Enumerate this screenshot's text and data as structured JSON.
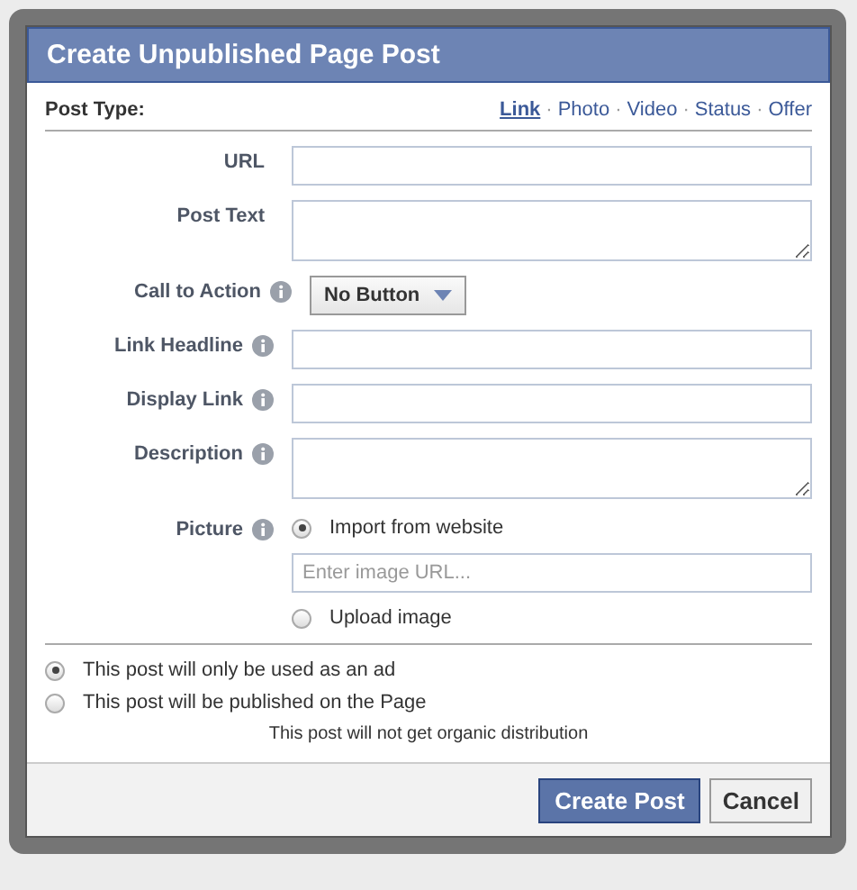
{
  "dialog": {
    "title": "Create Unpublished Page Post",
    "post_type": {
      "label": "Post Type:",
      "options": [
        {
          "label": "Link",
          "selected": true
        },
        {
          "separator": "·",
          "label": "Photo",
          "selected": false
        },
        {
          "separator": "·",
          "label": "Video",
          "selected": false
        },
        {
          "separator": "·",
          "label": "Status",
          "selected": false
        },
        {
          "separator": "·",
          "label": "Offer",
          "selected": false
        }
      ]
    },
    "fields": [
      {
        "kind": "text",
        "label": "URL",
        "info": false
      },
      {
        "kind": "textarea",
        "label": "Post Text",
        "info": false
      },
      {
        "kind": "dropdown",
        "label": "Call to Action",
        "info": true,
        "value": "No Button"
      },
      {
        "kind": "text",
        "label": "Link Headline",
        "info": true
      },
      {
        "kind": "text",
        "label": "Display Link",
        "info": true
      },
      {
        "kind": "textarea",
        "label": "Description",
        "info": true
      },
      {
        "kind": "picture",
        "label": "Picture",
        "info": true,
        "placeholder": "Enter image URL...",
        "choices": [
          {
            "label": "Import from website",
            "selected": true
          },
          {
            "label": "Upload image",
            "selected": false
          }
        ]
      }
    ],
    "distribution": {
      "options": [
        {
          "label": "This post will only be used as an ad",
          "selected": true
        },
        {
          "label": "This post will be published on the Page",
          "selected": false
        }
      ],
      "note": "This post will not get organic distribution"
    },
    "buttons": [
      {
        "label": "Create Post",
        "kind": "primary"
      },
      {
        "label": "Cancel",
        "kind": "secondary"
      }
    ]
  }
}
